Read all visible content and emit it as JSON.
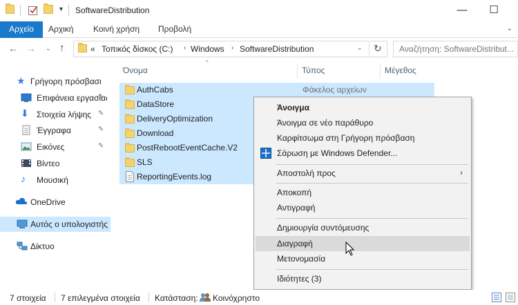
{
  "window": {
    "title": "SoftwareDistribution",
    "minimize_symbol": "—",
    "maximize_symbol": "☐"
  },
  "ribbon": {
    "tabs": [
      {
        "label": "Αρχείο"
      },
      {
        "label": "Αρχική"
      },
      {
        "label": "Κοινή χρήση"
      },
      {
        "label": "Προβολή"
      }
    ]
  },
  "address": {
    "overflow": "«",
    "crumbs": [
      "Τοπικός δίσκος (C:)",
      "Windows",
      "SoftwareDistribution"
    ]
  },
  "search": {
    "placeholder": "Αναζήτηση: SoftwareDistribut..."
  },
  "sidebar": {
    "items": [
      {
        "label": "Γρήγορη πρόσβαση",
        "icon": "star-icon"
      },
      {
        "label": "Επιφάνεια εργασίας",
        "icon": "desktop-icon"
      },
      {
        "label": "Στοιχεία λήψης",
        "icon": "download-icon"
      },
      {
        "label": "Έγγραφα",
        "icon": "documents-icon"
      },
      {
        "label": "Εικόνες",
        "icon": "pictures-icon"
      },
      {
        "label": "Βίντεο",
        "icon": "video-icon"
      },
      {
        "label": "Μουσική",
        "icon": "music-icon"
      },
      {
        "label": "OneDrive",
        "icon": "cloud-icon"
      },
      {
        "label": "Αυτός ο υπολογιστής",
        "icon": "computer-icon"
      },
      {
        "label": "Δίκτυο",
        "icon": "network-icon"
      }
    ]
  },
  "columns": {
    "name": "Όνομα",
    "type": "Τύπος",
    "size": "Μέγεθος"
  },
  "files": [
    {
      "name": "AuthCabs",
      "type": "Φάκελος αρχείων",
      "kind": "folder"
    },
    {
      "name": "DataStore",
      "type": "",
      "kind": "folder"
    },
    {
      "name": "DeliveryOptimization",
      "type": "",
      "kind": "folder"
    },
    {
      "name": "Download",
      "type": "",
      "kind": "folder"
    },
    {
      "name": "PostRebootEventCache.V2",
      "type": "",
      "kind": "folder"
    },
    {
      "name": "SLS",
      "type": "",
      "kind": "folder"
    },
    {
      "name": "ReportingEvents.log",
      "type": "",
      "kind": "text-file"
    }
  ],
  "context_menu": {
    "open": "Άνοιγμα",
    "open_new_window": "Άνοιγμα σε νέο παράθυρο",
    "pin_quick_access": "Καρφίτσωμα στη Γρήγορη πρόσβαση",
    "scan_defender": "Σάρωση με Windows Defender...",
    "send_to": "Αποστολή προς",
    "cut": "Αποκοπή",
    "copy": "Αντιγραφή",
    "create_shortcut": "Δημιουργία συντόμευσης",
    "delete": "Διαγραφή",
    "rename": "Μετονομασία",
    "properties": "Ιδιότητες (3)"
  },
  "status": {
    "item_count": "7 στοιχεία",
    "selected_count": "7 επιλεγμένα στοιχεία",
    "state_label": "Κατάσταση:",
    "state_value": "Κοινόχρηστο"
  },
  "colors": {
    "accent": "#1979ca",
    "selection": "#cce8ff",
    "folder": "#f5d36c"
  }
}
